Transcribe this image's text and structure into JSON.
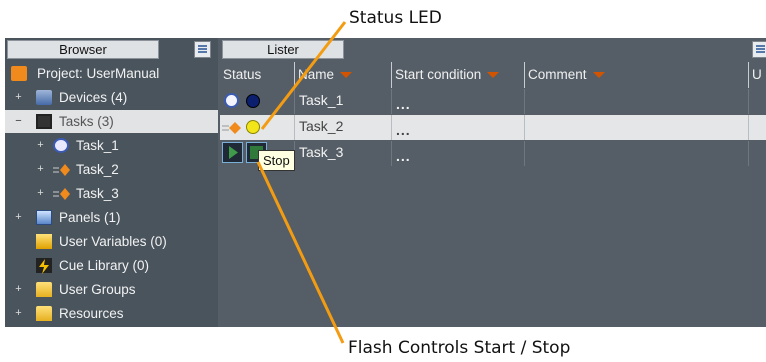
{
  "callouts": {
    "status_led": "Status LED",
    "flash_controls": "Flash Controls Start / Stop"
  },
  "browser": {
    "tab_label": "Browser",
    "items": [
      {
        "label": "Project: UserManual",
        "icon": "project-icon",
        "expander": ""
      },
      {
        "label": "Devices (4)",
        "icon": "devices-icon",
        "expander": "+"
      },
      {
        "label": "Tasks (3)",
        "icon": "tasks-folder-icon",
        "expander": "−",
        "selected": true
      },
      {
        "label": "Task_1",
        "icon": "clock-icon",
        "expander": "+"
      },
      {
        "label": "Task_2",
        "icon": "flash-task-icon",
        "expander": "+"
      },
      {
        "label": "Task_3",
        "icon": "flash-task-icon",
        "expander": "+"
      },
      {
        "label": "Panels (1)",
        "icon": "panels-icon",
        "expander": "+"
      },
      {
        "label": "User Variables (0)",
        "icon": "variables-icon",
        "expander": ""
      },
      {
        "label": "Cue Library (0)",
        "icon": "cue-library-icon",
        "expander": ""
      },
      {
        "label": "User Groups",
        "icon": "folder-icon",
        "expander": "+"
      },
      {
        "label": "Resources",
        "icon": "folder-icon",
        "expander": "+"
      }
    ]
  },
  "lister": {
    "tab_label": "Lister",
    "columns": [
      "Status",
      "Name",
      "Start condition",
      "Comment",
      "U"
    ],
    "rows": [
      {
        "name": "Task_1",
        "start_condition": "...",
        "status_led": "#0b1f6e"
      },
      {
        "name": "Task_2",
        "start_condition": "...",
        "status_led": "#f2e51a",
        "selected": true
      },
      {
        "name": "Task_3",
        "start_condition": "...",
        "status_led": "stop"
      }
    ],
    "tooltip": "Stop"
  },
  "colors": {
    "callout_line": "#f39c12",
    "sort_arrow": "#d35400"
  }
}
